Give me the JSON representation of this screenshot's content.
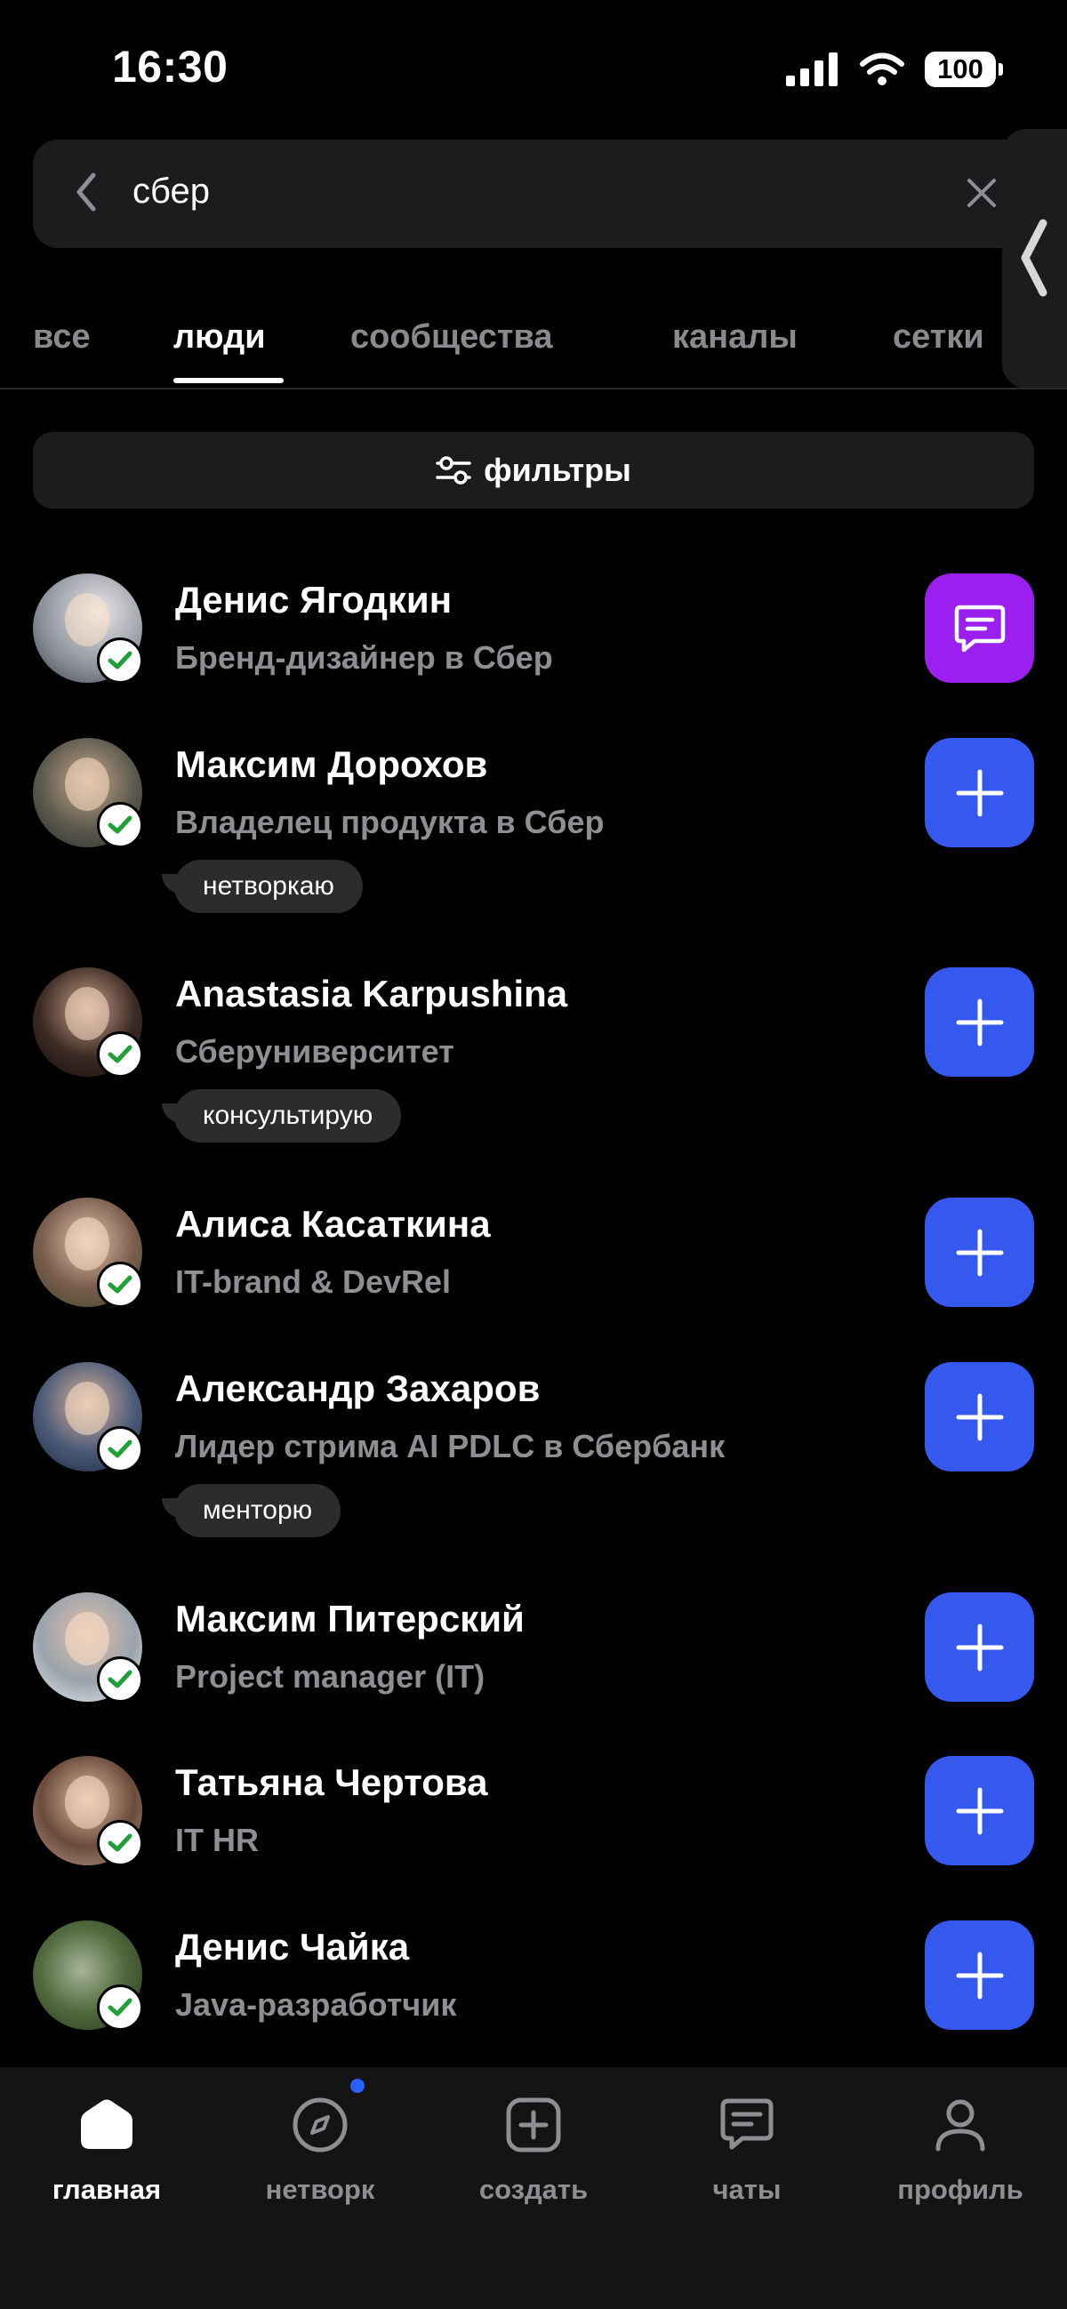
{
  "status_bar": {
    "time": "16:30",
    "battery": "100"
  },
  "search": {
    "query": "сбер"
  },
  "tabs": [
    {
      "label": "все"
    },
    {
      "label": "люди"
    },
    {
      "label": "сообщества"
    },
    {
      "label": "каналы"
    },
    {
      "label": "сетки"
    }
  ],
  "active_tab": "люди",
  "filters": {
    "label": "фильтры"
  },
  "people": [
    {
      "name": "Денис Ягодкин",
      "role": "Бренд-дизайнер в Сбер",
      "tag": "",
      "action": "message-icon"
    },
    {
      "name": "Максим Дорохов",
      "role": "Владелец продукта в Сбер",
      "tag": "нетворкаю",
      "action": "plus-icon"
    },
    {
      "name": "Anastasia Karpushina",
      "role": "Сберуниверситет",
      "tag": "консультирую",
      "action": "plus-icon"
    },
    {
      "name": "Алиса Касаткина",
      "role": "IT-brand & DevRel",
      "tag": "",
      "action": "plus-icon"
    },
    {
      "name": "Александр Захаров",
      "role": "Лидер стрима AI PDLC в Сбербанк",
      "tag": "менторю",
      "action": "plus-icon"
    },
    {
      "name": "Максим Питерский",
      "role": "Project manager (IT)",
      "tag": "",
      "action": "plus-icon"
    },
    {
      "name": "Татьяна Чертова",
      "role": "IT HR",
      "tag": "",
      "action": "plus-icon"
    },
    {
      "name": "Денис Чайка",
      "role": "Java-разработчик",
      "tag": "",
      "action": "plus-icon"
    }
  ],
  "bottom_nav": [
    {
      "label": "главная",
      "icon": "home-icon"
    },
    {
      "label": "нетворк",
      "icon": "compass-icon"
    },
    {
      "label": "создать",
      "icon": "plus-square-icon"
    },
    {
      "label": "чаты",
      "icon": "chat-icon"
    },
    {
      "label": "профиль",
      "icon": "profile-icon"
    }
  ],
  "colors": {
    "add_button": "#3558ee",
    "message_button": "#9b20f0",
    "notification_dot": "#2a60ff"
  }
}
